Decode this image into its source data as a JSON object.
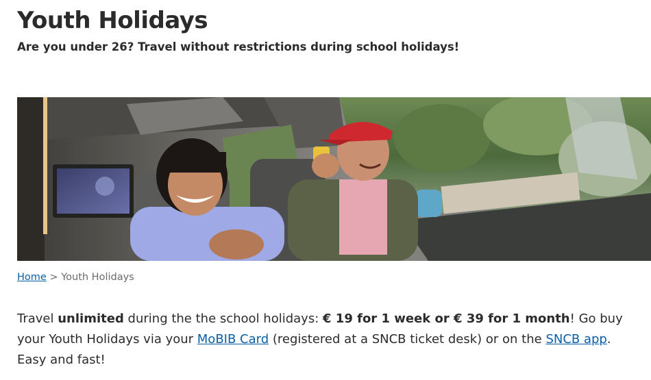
{
  "page": {
    "title": "Youth Holidays",
    "subtitle": "Are you under 26? Travel without restrictions during school holidays!"
  },
  "hero": {
    "image_description_icon": "hero-photo-icon"
  },
  "breadcrumb": {
    "home_label": "Home",
    "separator": ">",
    "current_label": "Youth Holidays"
  },
  "body": {
    "seg1": "Travel ",
    "seg2_bold": "unlimited",
    "seg3": " during the the school holidays: ",
    "seg4_bold": "€ 19 for 1 week or € 39 for 1 month",
    "seg5": "! Go buy your Youth Holidays via your ",
    "mobib_link": "MoBIB Card",
    "seg6": " (registered at a SNCB ticket desk) or on the ",
    "sncb_link": "SNCB app",
    "seg7": ". Easy and fast!"
  },
  "colors": {
    "link": "#0a5fa8",
    "text": "#2b2b2b",
    "muted": "#6a6a6a"
  }
}
